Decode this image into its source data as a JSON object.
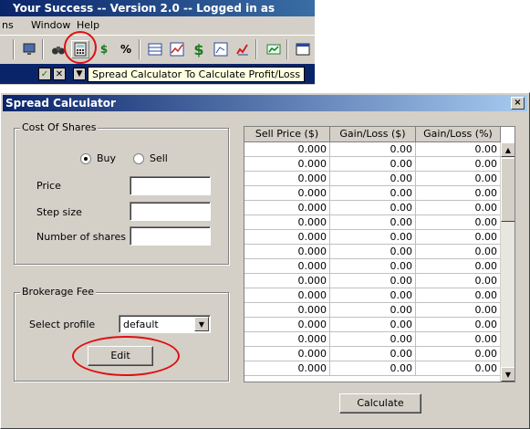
{
  "app": {
    "title": "Your Success -- Version 2.0 -- Logged in as",
    "menu": [
      "ns",
      "Window",
      "Help"
    ],
    "tooltip": "Spread Calculator To Calculate Profit/Loss"
  },
  "toolbar": {
    "icons": [
      "monitor-icon",
      "binoculars-icon",
      "calculator-icon",
      "dollar-arrows-icon",
      "percent-icon",
      "table-icon",
      "chart-icon",
      "dollar-icon",
      "graph-icon",
      "pencil-icon",
      "green-chart-icon",
      "window-icon"
    ],
    "glyphs": {
      "percent": "%",
      "dollar": "$"
    }
  },
  "dialog": {
    "title": "Spread Calculator",
    "close": "×",
    "cost_group": {
      "title": "Cost Of Shares",
      "buy": "Buy",
      "sell": "Sell",
      "selected": "Buy",
      "price_label": "Price",
      "step_label": "Step size",
      "shares_label": "Number of shares",
      "price_value": "",
      "step_value": "",
      "shares_value": ""
    },
    "fee_group": {
      "title": "Brokerage Fee",
      "profile_label": "Select profile",
      "profile_value": "default",
      "edit_button": "Edit"
    },
    "grid": {
      "columns": [
        "Sell Price ($)",
        "Gain/Loss ($)",
        "Gain/Loss (%)"
      ],
      "rows": [
        [
          "0.000",
          "0.00",
          "0.00"
        ],
        [
          "0.000",
          "0.00",
          "0.00"
        ],
        [
          "0.000",
          "0.00",
          "0.00"
        ],
        [
          "0.000",
          "0.00",
          "0.00"
        ],
        [
          "0.000",
          "0.00",
          "0.00"
        ],
        [
          "0.000",
          "0.00",
          "0.00"
        ],
        [
          "0.000",
          "0.00",
          "0.00"
        ],
        [
          "0.000",
          "0.00",
          "0.00"
        ],
        [
          "0.000",
          "0.00",
          "0.00"
        ],
        [
          "0.000",
          "0.00",
          "0.00"
        ],
        [
          "0.000",
          "0.00",
          "0.00"
        ],
        [
          "0.000",
          "0.00",
          "0.00"
        ],
        [
          "0.000",
          "0.00",
          "0.00"
        ],
        [
          "0.000",
          "0.00",
          "0.00"
        ],
        [
          "0.000",
          "0.00",
          "0.00"
        ],
        [
          "0.000",
          "0.00",
          "0.00"
        ]
      ]
    },
    "calculate_button": "Calculate"
  },
  "colors": {
    "title_bar": "#0a246a",
    "dialog_face": "#d4d0c8",
    "highlight_annotation": "#e01010",
    "tooltip_bg": "#ffffe1"
  }
}
